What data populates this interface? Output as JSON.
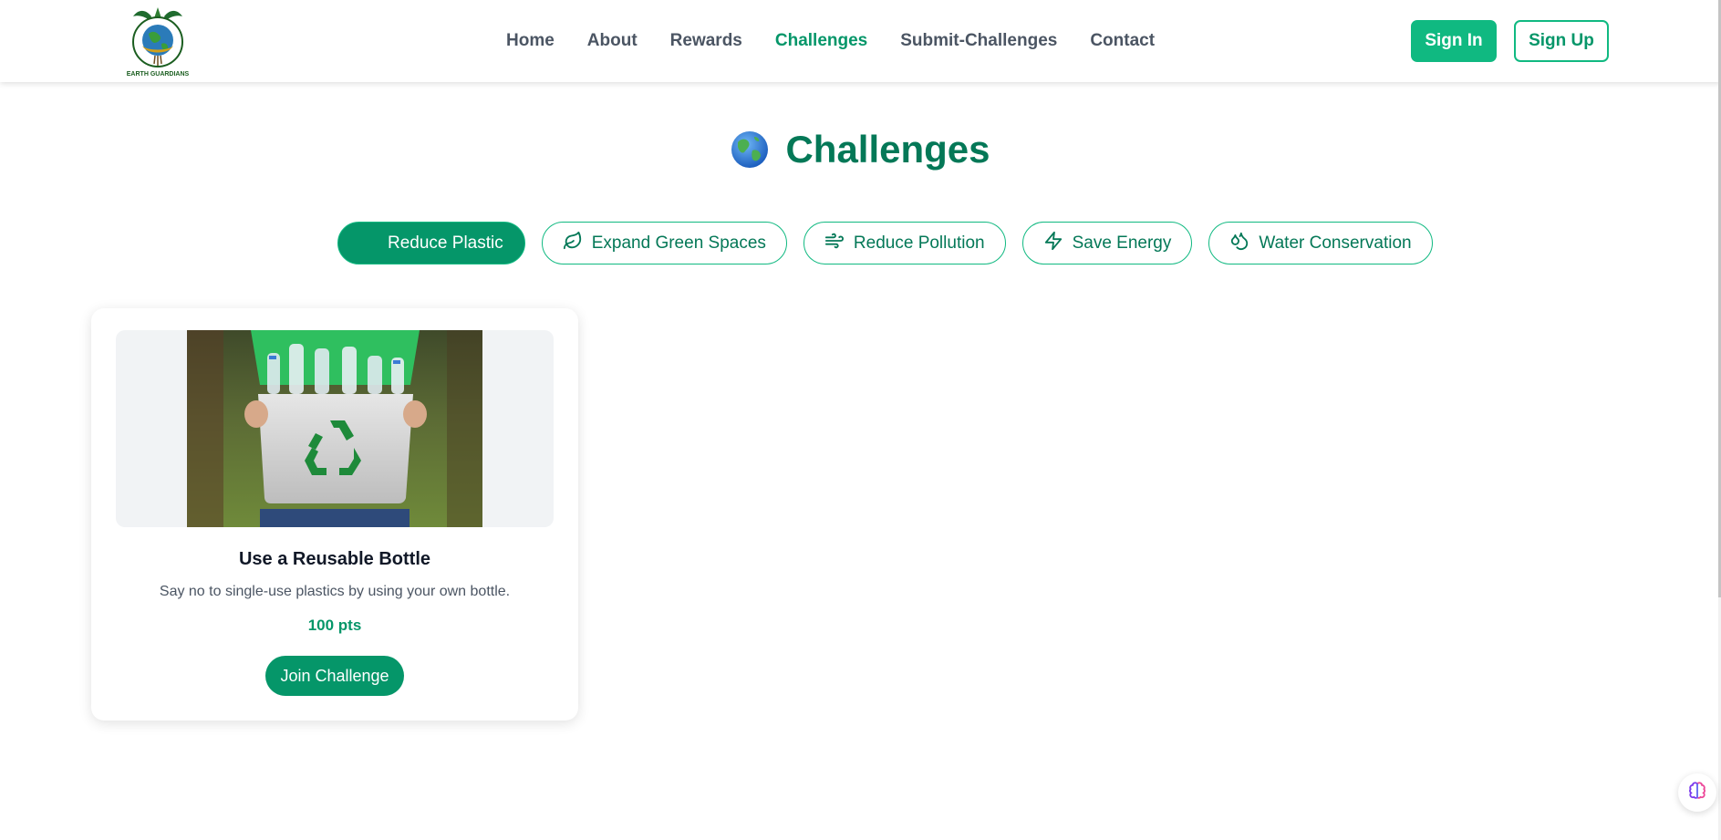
{
  "header": {
    "logo_text": "EARTH GUARDIANS",
    "nav": [
      {
        "label": "Home",
        "active": false
      },
      {
        "label": "About",
        "active": false
      },
      {
        "label": "Rewards",
        "active": false
      },
      {
        "label": "Challenges",
        "active": true
      },
      {
        "label": "Submit-Challenges",
        "active": false
      },
      {
        "label": "Contact",
        "active": false
      }
    ],
    "sign_in_label": "Sign In",
    "sign_up_label": "Sign Up"
  },
  "main": {
    "title": "Challenges",
    "title_icon": "globe-icon",
    "categories": [
      {
        "label": "Reduce Plastic",
        "icon": "",
        "active": true
      },
      {
        "label": "Expand Green Spaces",
        "icon": "leaf-icon",
        "active": false
      },
      {
        "label": "Reduce Pollution",
        "icon": "wind-icon",
        "active": false
      },
      {
        "label": "Save Energy",
        "icon": "lightning-icon",
        "active": false
      },
      {
        "label": "Water Conservation",
        "icon": "droplets-icon",
        "active": false
      }
    ],
    "challenges": [
      {
        "title": "Use a Reusable Bottle",
        "description": "Say no to single-use plastics by using your own bottle.",
        "points": "100 pts",
        "button_label": "Join Challenge",
        "image_icon": "recycling-bin-photo"
      }
    ]
  },
  "floating": {
    "icon": "brain-icon"
  },
  "colors": {
    "primary": "#059669",
    "primary_light": "#10b981",
    "title_green": "#047857",
    "nav_text": "#4b5563"
  }
}
